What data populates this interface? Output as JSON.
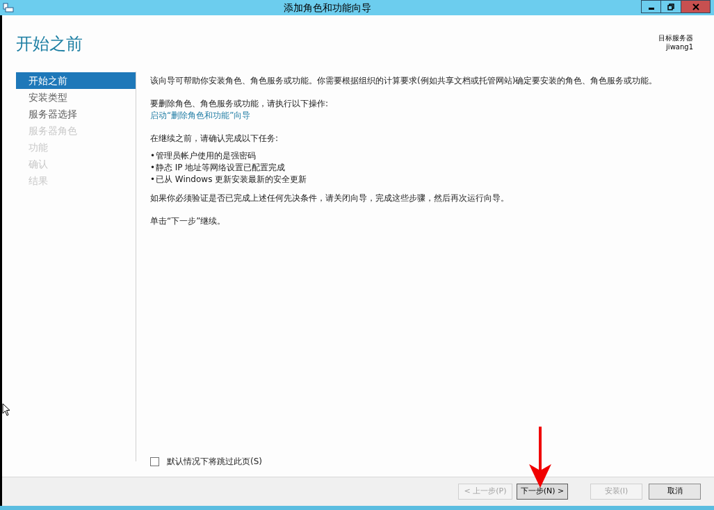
{
  "window": {
    "title": "添加角色和功能向导"
  },
  "header": {
    "title": "开始之前",
    "target_label": "目标服务器",
    "target_value": "jiwang1"
  },
  "sidebar": {
    "items": [
      {
        "label": "开始之前",
        "selected": true,
        "disabled": false
      },
      {
        "label": "安装类型",
        "selected": false,
        "disabled": false
      },
      {
        "label": "服务器选择",
        "selected": false,
        "disabled": false
      },
      {
        "label": "服务器角色",
        "selected": false,
        "disabled": true
      },
      {
        "label": "功能",
        "selected": false,
        "disabled": true
      },
      {
        "label": "确认",
        "selected": false,
        "disabled": true
      },
      {
        "label": "结果",
        "selected": false,
        "disabled": true
      }
    ]
  },
  "content": {
    "intro": "该向导可帮助你安装角色、角色服务或功能。你需要根据组织的计算要求(例如共享文档或托管网站)确定要安装的角色、角色服务或功能。",
    "remove_prompt": "要删除角色、角色服务或功能，请执行以下操作:",
    "remove_link": "启动“删除角色和功能”向导",
    "prereq_heading": "在继续之前，请确认完成以下任务:",
    "bullets": [
      {
        "marker": "•",
        "text": "管理员帐户使用的是强密码"
      },
      {
        "marker": "•",
        "text": "静态 IP 地址等网络设置已配置完成"
      },
      {
        "marker": "•",
        "text": "已从 Windows 更新安装最新的安全更新"
      }
    ],
    "verify_note": "如果你必须验证是否已完成上述任何先决条件，请关闭向导，完成这些步骤，然后再次运行向导。",
    "continue_note": "单击“下一步”继续。"
  },
  "skip_checkbox": {
    "label": "默认情况下将跳过此页(S)",
    "checked": false
  },
  "buttons": [
    {
      "label": "< 上一步(P)",
      "disabled": true,
      "focused": false
    },
    {
      "label": "下一步(N) >",
      "disabled": false,
      "focused": true
    },
    {
      "label": "安装(I)",
      "disabled": true,
      "focused": false
    },
    {
      "label": "取消",
      "disabled": false,
      "focused": false
    }
  ]
}
